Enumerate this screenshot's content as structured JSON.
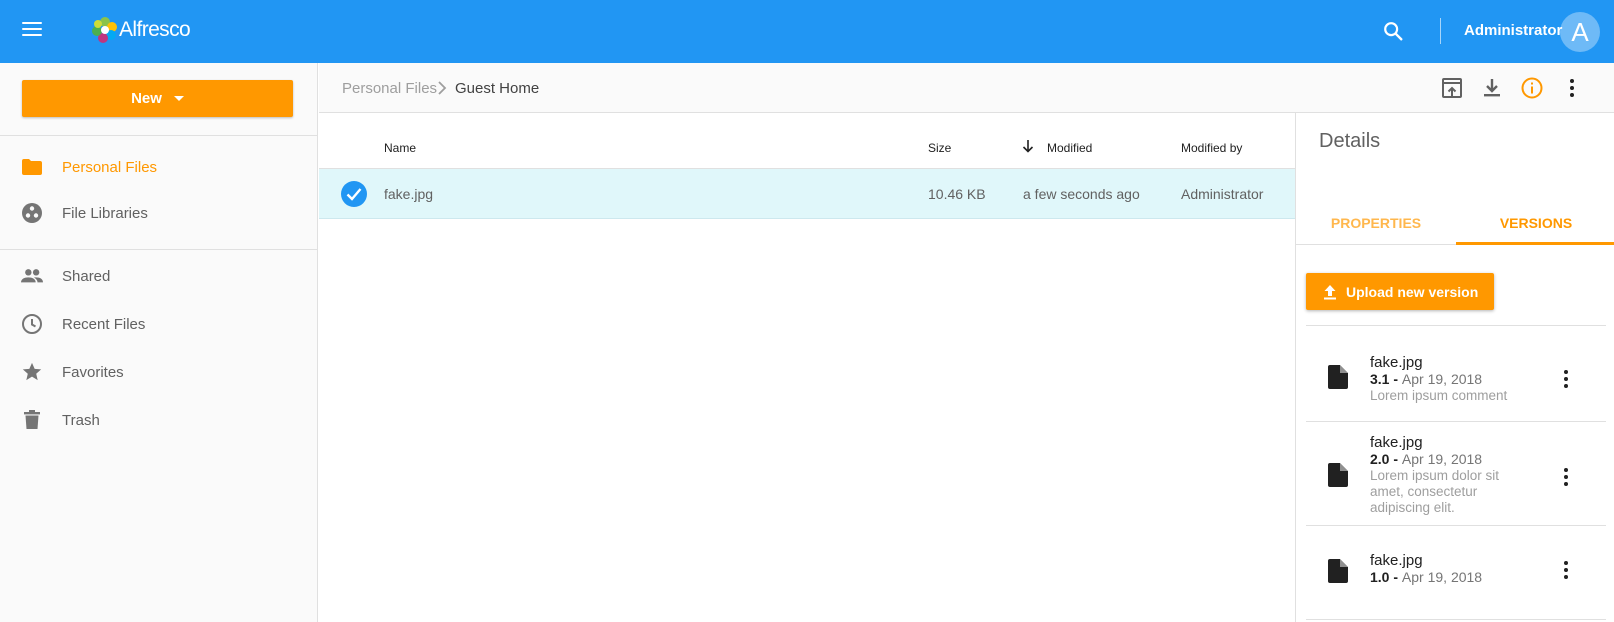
{
  "app": {
    "logo_text": "Alfresco",
    "accent": "#ff9800",
    "brand": "#2196f3"
  },
  "topbar": {
    "username": "Administrator",
    "avatar_letter": "A"
  },
  "sidebar": {
    "new_label": "New",
    "items": [
      {
        "label": "Personal Files",
        "icon": "folder-icon",
        "active": true
      },
      {
        "label": "File Libraries",
        "icon": "libraries-icon"
      },
      {
        "label": "Shared",
        "icon": "people-icon"
      },
      {
        "label": "Recent Files",
        "icon": "clock-icon"
      },
      {
        "label": "Favorites",
        "icon": "star-icon"
      },
      {
        "label": "Trash",
        "icon": "trash-icon"
      }
    ]
  },
  "breadcrumb": {
    "items": [
      "Personal Files",
      "Guest Home"
    ]
  },
  "list": {
    "columns": {
      "name": "Name",
      "size": "Size",
      "modified": "Modified",
      "modified_by": "Modified by"
    },
    "rows": [
      {
        "name": "fake.jpg",
        "size": "10.46 KB",
        "modified": "a few seconds ago",
        "modified_by": "Administrator",
        "selected": true
      }
    ]
  },
  "details": {
    "title": "Details",
    "tabs": [
      "PROPERTIES",
      "VERSIONS"
    ],
    "upload_label": "Upload new version",
    "versions": [
      {
        "name": "fake.jpg",
        "version": "3.1",
        "date": "Apr 19, 2018",
        "comment": "Lorem ipsum comment"
      },
      {
        "name": "fake.jpg",
        "version": "2.0",
        "date": "Apr 19, 2018",
        "comment": "Lorem ipsum dolor sit amet, consectetur adipiscing elit."
      },
      {
        "name": "fake.jpg",
        "version": "1.0",
        "date": "Apr 19, 2018",
        "comment": ""
      }
    ]
  }
}
